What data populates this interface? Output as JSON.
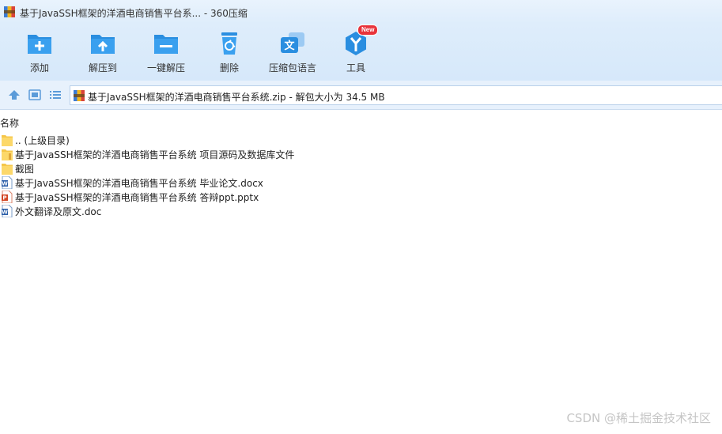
{
  "window": {
    "title": "基于JavaSSH框架的洋酒电商销售平台系... - 360压缩"
  },
  "toolbar": {
    "items": [
      {
        "label": "添加",
        "icon": "add-icon"
      },
      {
        "label": "解压到",
        "icon": "extract-to-icon"
      },
      {
        "label": "一键解压",
        "icon": "one-click-extract-icon"
      },
      {
        "label": "删除",
        "icon": "delete-icon"
      },
      {
        "label": "压缩包语言",
        "icon": "archive-language-icon"
      },
      {
        "label": "工具",
        "icon": "tools-icon",
        "badge": "New"
      }
    ]
  },
  "nav": {
    "path": "基于JavaSSH框架的洋酒电商销售平台系统.zip - 解包大小为 34.5 MB"
  },
  "list": {
    "column_name": "名称",
    "files": [
      {
        "name": ".. (上级目录)",
        "type": "folder"
      },
      {
        "name": "基于JavaSSH框架的洋酒电商销售平台系统 项目源码及数据库文件",
        "type": "folder"
      },
      {
        "name": "截图",
        "type": "folder"
      },
      {
        "name": "基于JavaSSH框架的洋酒电商销售平台系统 毕业论文.docx",
        "type": "word"
      },
      {
        "name": "基于JavaSSH框架的洋酒电商销售平台系统 答辩ppt.pptx",
        "type": "ppt"
      },
      {
        "name": "外文翻译及原文.doc",
        "type": "word"
      }
    ]
  },
  "watermark": "CSDN @稀土掘金技术社区",
  "colors": {
    "accent": "#2a8ee0",
    "folder": "#f5c64a",
    "word": "#2b5ea8",
    "ppt": "#d24625",
    "badge": "#e8333a"
  }
}
